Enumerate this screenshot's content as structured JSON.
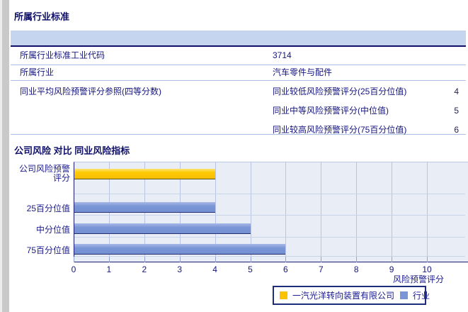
{
  "page": {
    "section1_title": "所属行业标准",
    "section2_title": "公司风险 对比 同业风险指标"
  },
  "table": {
    "rows": [
      {
        "label": "所属行业标准工业代码",
        "value": "3714"
      },
      {
        "label": "所属行业",
        "value": "汽车零件与配件"
      },
      {
        "label": "同业平均风险预警评分参照(四等分数)",
        "subrows": [
          {
            "label": "同业较低风险预警评分(25百分位值)",
            "value": "4"
          },
          {
            "label": "同业中等风险预警评分(中位值)",
            "value": "5"
          },
          {
            "label": "同业较高风险预警评分(75百分位值)",
            "value": "6"
          }
        ]
      }
    ]
  },
  "chart_data": {
    "type": "bar",
    "orientation": "horizontal",
    "title": "公司风险 对比 同业风险指标",
    "categories": [
      "公司风险预警评分",
      "25百分位值",
      "中分位值",
      "75百分位值"
    ],
    "bars": [
      {
        "category": "公司风险预警评分",
        "series": "一汽光洋转向装置有限公司",
        "value": 4
      },
      {
        "category": "25百分位值",
        "series": "行业",
        "value": 4
      },
      {
        "category": "中分位值",
        "series": "行业",
        "value": 5
      },
      {
        "category": "75百分位值",
        "series": "行业",
        "value": 6
      }
    ],
    "series": [
      {
        "name": "一汽光洋转向装置有限公司",
        "color": "#fcc200"
      },
      {
        "name": "行业",
        "color": "#7b96d6"
      }
    ],
    "xlabel": "风险预警评分",
    "xlim": [
      0,
      10
    ],
    "xticks": [
      0,
      1,
      2,
      3,
      4,
      5,
      6,
      7,
      8,
      9,
      10
    ],
    "grid": true,
    "legend_position": "bottom-right"
  },
  "palette": {
    "title_navy": "#10106a",
    "text_navy": "#1a1a8c",
    "table_header_band": "#c6d5ef",
    "table_divider": "#a9c0e2",
    "plot_background": "#e9edf6",
    "gridline": "#b9c4e3",
    "company_bar": "#fcc200",
    "industry_bar": "#7b96d6"
  }
}
